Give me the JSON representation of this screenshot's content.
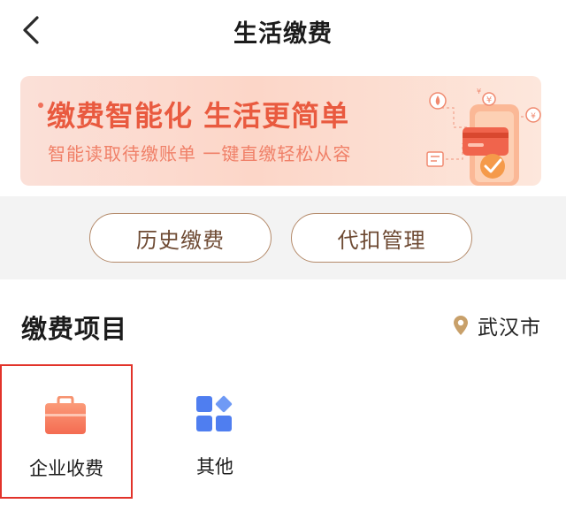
{
  "header": {
    "title": "生活缴费"
  },
  "banner": {
    "headline": "缴费智能化  生活更简单",
    "subtitle": "智能读取待缴账单  一键直缴轻松从容"
  },
  "actions": {
    "history_label": "历史缴费",
    "debit_label": "代扣管理"
  },
  "section": {
    "title": "缴费项目",
    "city": "武汉市"
  },
  "items": [
    {
      "label": "企业收费",
      "icon": "briefcase-icon",
      "selected": true
    },
    {
      "label": "其他",
      "icon": "grid-icon",
      "selected": false
    }
  ],
  "colors": {
    "accent_orange": "#e95a3f",
    "pill_border": "#b48a6a",
    "pill_text": "#6e4a33",
    "selection_red": "#e2332a",
    "blue_icon": "#4f7ef0"
  }
}
